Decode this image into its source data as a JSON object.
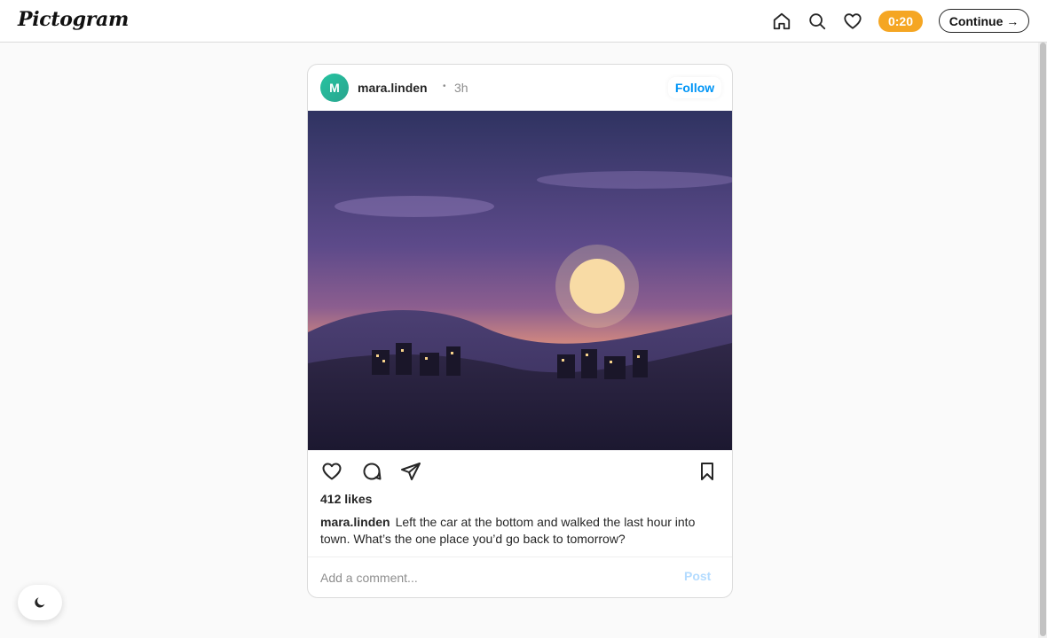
{
  "app": {
    "logo": "Pictogram"
  },
  "topbar": {
    "icons": [
      "home-icon",
      "search-icon",
      "heart-icon"
    ],
    "timer": "0:20",
    "timer_color": "#f5a623",
    "continue_label": "Continue →"
  },
  "post": {
    "avatar_letter": "M",
    "username": "mara.linden",
    "dot": "•",
    "time": "3h",
    "follow_label": "Follow",
    "image_description_icon": "landscape-illustration",
    "likes": "412 likes",
    "caption_user": "mara.linden",
    "caption_text": "Left the car at the bottom and walked the last hour into town. What’s the one place you’d go back to tomorrow?",
    "comment_placeholder": "Add a comment...",
    "post_label": "Post",
    "action_icons": [
      "heart-icon",
      "comment-icon",
      "share-icon",
      "bookmark-icon"
    ]
  },
  "theme_toggle": {
    "icon": "moon-icon"
  },
  "colors": {
    "accent": "#0095f6",
    "post_disabled": "#b3dbff",
    "avatar": "#25c3a0"
  }
}
